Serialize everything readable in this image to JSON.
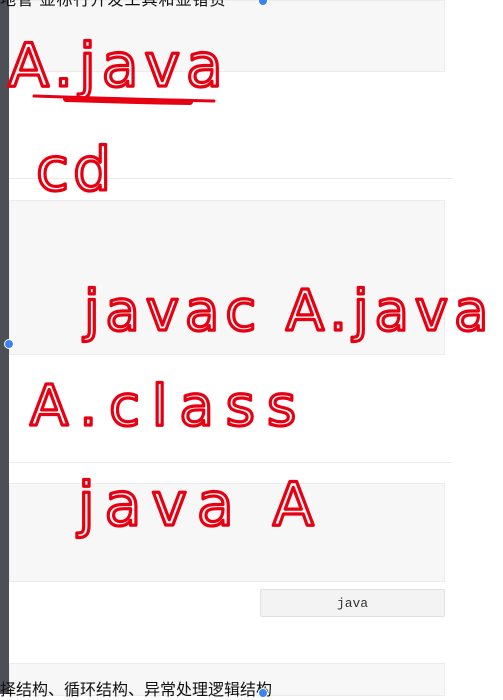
{
  "document": {
    "top_text": "地管  显标行开发工具和显错资",
    "code_lang_label": "java",
    "bottom_text": "择结构、循环结构、异常处理逻辑结构"
  },
  "annotations": {
    "line1": "A.java",
    "line2": "cd",
    "line3": "javac A.java",
    "line4": "A.class",
    "line5": "java A",
    "color": "#e60012"
  }
}
